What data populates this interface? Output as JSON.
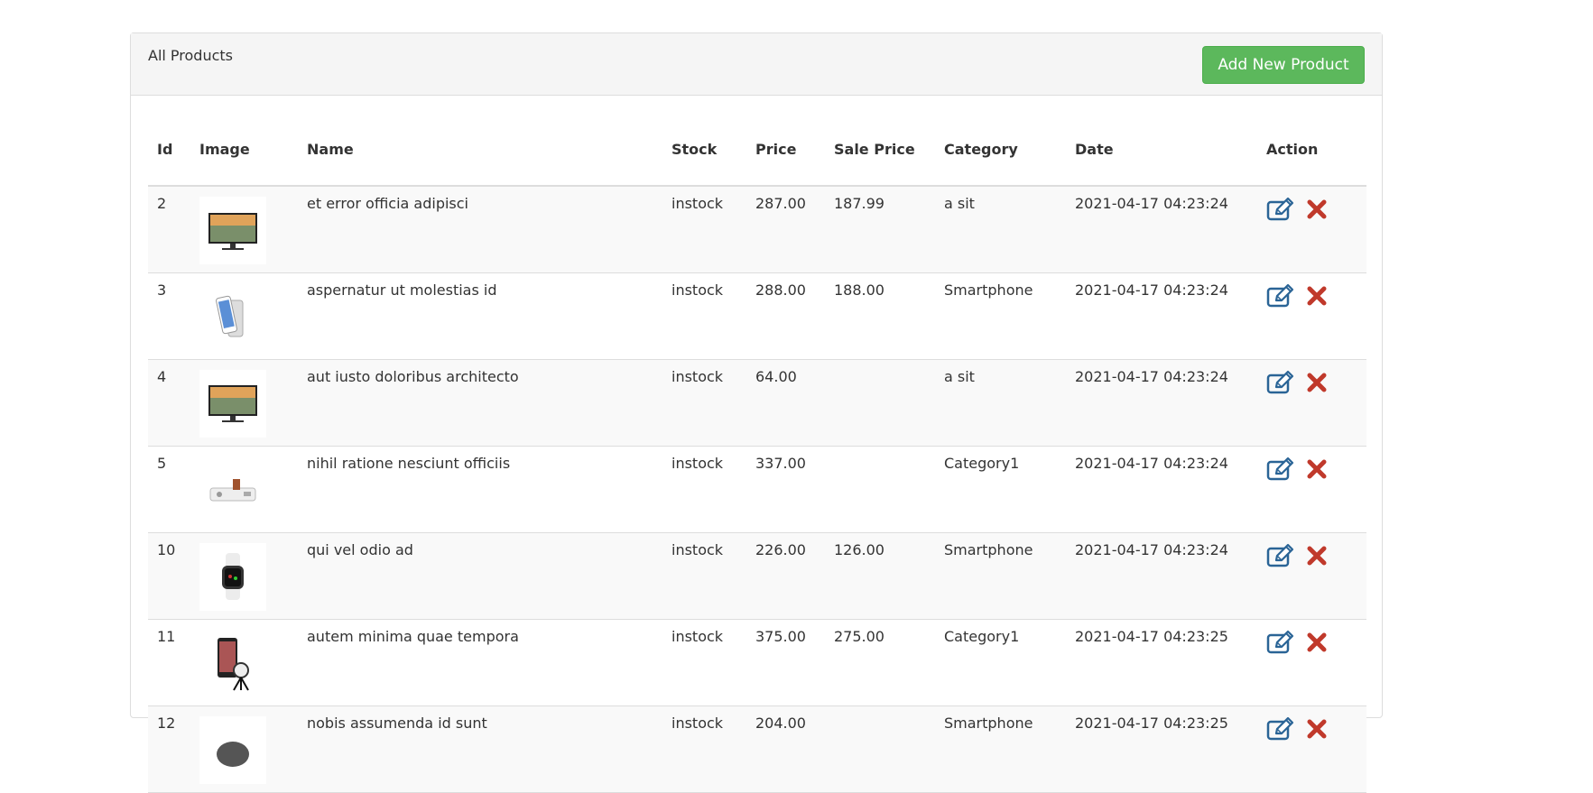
{
  "panel": {
    "title": "All Products",
    "add_button_label": "Add New Product"
  },
  "table": {
    "headers": {
      "id": "Id",
      "image": "Image",
      "name": "Name",
      "stock": "Stock",
      "price": "Price",
      "sale_price": "Sale Price",
      "category": "Category",
      "date": "Date",
      "action": "Action"
    },
    "rows": [
      {
        "id": "2",
        "image": "tv-image",
        "name": "et error officia adipisci",
        "stock": "instock",
        "price": "287.00",
        "sale_price": "187.99",
        "category": "a sit",
        "date": "2021-04-17 04:23:24"
      },
      {
        "id": "3",
        "image": "smartphone-image",
        "name": "aspernatur ut molestias id",
        "stock": "instock",
        "price": "288.00",
        "sale_price": "188.00",
        "category": "Smartphone",
        "date": "2021-04-17 04:23:24"
      },
      {
        "id": "4",
        "image": "tv-image",
        "name": "aut iusto doloribus architecto",
        "stock": "instock",
        "price": "64.00",
        "sale_price": "",
        "category": "a sit",
        "date": "2021-04-17 04:23:24"
      },
      {
        "id": "5",
        "image": "speaker-dock-image",
        "name": "nihil ratione nesciunt officiis",
        "stock": "instock",
        "price": "337.00",
        "sale_price": "",
        "category": "Category1",
        "date": "2021-04-17 04:23:24"
      },
      {
        "id": "10",
        "image": "smartwatch-image",
        "name": "qui vel odio ad",
        "stock": "instock",
        "price": "226.00",
        "sale_price": "126.00",
        "category": "Smartphone",
        "date": "2021-04-17 04:23:24"
      },
      {
        "id": "11",
        "image": "phone-camera-image",
        "name": "autem minima quae tempora",
        "stock": "instock",
        "price": "375.00",
        "sale_price": "275.00",
        "category": "Category1",
        "date": "2021-04-17 04:23:25"
      },
      {
        "id": "12",
        "image": "product-image",
        "name": "nobis assumenda id sunt",
        "stock": "instock",
        "price": "204.00",
        "sale_price": "",
        "category": "Smartphone",
        "date": "2021-04-17 04:23:25"
      }
    ]
  },
  "icons": {
    "edit": "edit-icon",
    "delete": "delete-icon"
  },
  "colors": {
    "add_button": "#5cb85c",
    "edit_icon": "#2a6496",
    "delete_icon": "#c0392b",
    "heading_bg": "#f5f5f5",
    "stripe_bg": "#f9f9f9"
  }
}
